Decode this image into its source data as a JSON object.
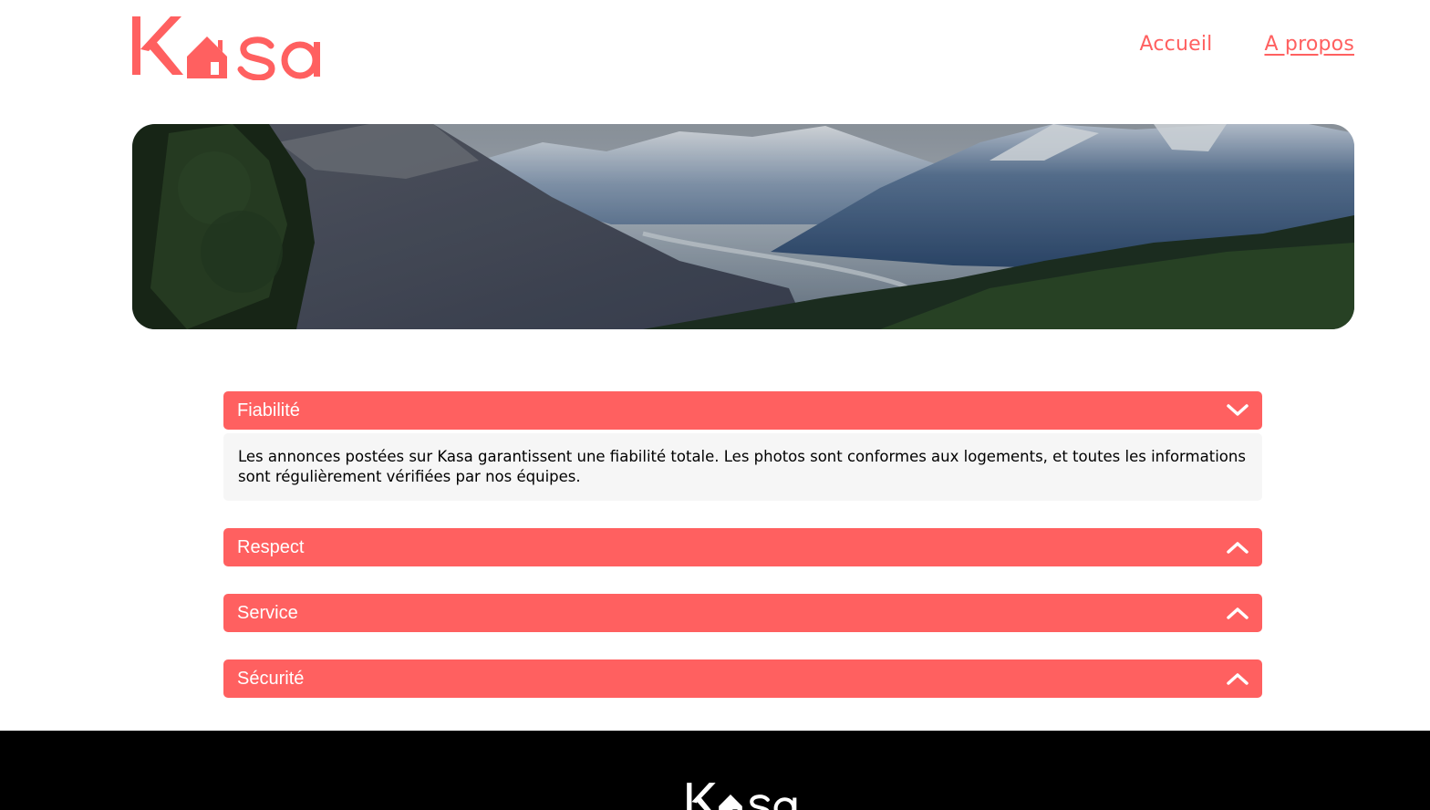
{
  "header": {
    "logo_text": "Kasa",
    "nav": [
      {
        "label": "Accueil",
        "active": false
      },
      {
        "label": "A propos",
        "active": true
      }
    ]
  },
  "banner": {
    "image_alt": "mountain-valley-landscape"
  },
  "collapses": [
    {
      "title": "Fiabilité",
      "open": true,
      "icon": "chevron-down-icon",
      "body": "Les annonces postées sur Kasa garantissent une fiabilité totale. Les photos sont conformes aux logements, et toutes les informations sont régulièrement vérifiées par nos équipes."
    },
    {
      "title": "Respect",
      "open": false,
      "icon": "chevron-up-icon"
    },
    {
      "title": "Service",
      "open": false,
      "icon": "chevron-up-icon"
    },
    {
      "title": "Sécurité",
      "open": false,
      "icon": "chevron-up-icon"
    }
  ],
  "footer": {
    "logo_text": "Kasa"
  },
  "colors": {
    "brand": "#FF6060",
    "body_bg": "#F6F6F6",
    "footer_bg": "#000000"
  }
}
